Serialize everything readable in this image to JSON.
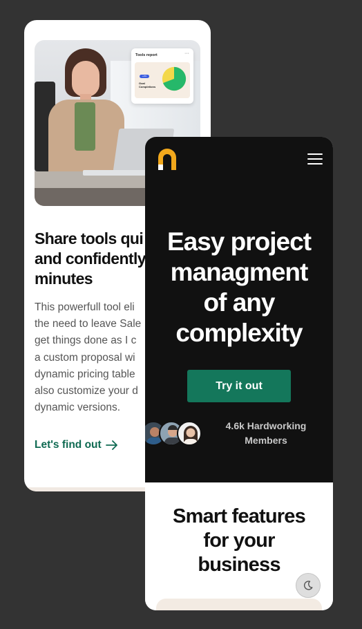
{
  "back_card": {
    "tools_report": {
      "title": "Tools report",
      "menu": "···",
      "badge": "+2%",
      "label": "Goal Completions",
      "pie_colors": [
        "#26b86a",
        "#f3d84a"
      ]
    },
    "title_lines": [
      "Share tools qui",
      "and confidently",
      "minutes"
    ],
    "body_lines": [
      "This powerfull tool eli",
      "the need to leave Sale",
      "get things done as I c",
      "a custom proposal wi",
      "dynamic pricing table",
      "also customize your d",
      "dynamic versions."
    ],
    "link_label": "Let's find out",
    "link_icon": "arrow-right-icon"
  },
  "phone": {
    "logo_icon": "brand-logo-icon",
    "menu_icon": "hamburger-menu-icon",
    "hero_lines": [
      "Easy project",
      "managment",
      "of any",
      "complexity"
    ],
    "cta_label": "Try it out",
    "members_lines": [
      "4.6k Hardworking",
      "Members"
    ],
    "features_lines": [
      "Smart features",
      "for your",
      "business"
    ],
    "theme_toggle_icon": "moon-icon"
  },
  "colors": {
    "page_bg": "#333333",
    "accent_green": "#14775b",
    "link_green": "#0f6a52",
    "logo_orange": "#f2a81c",
    "hero_bg": "#111111"
  }
}
